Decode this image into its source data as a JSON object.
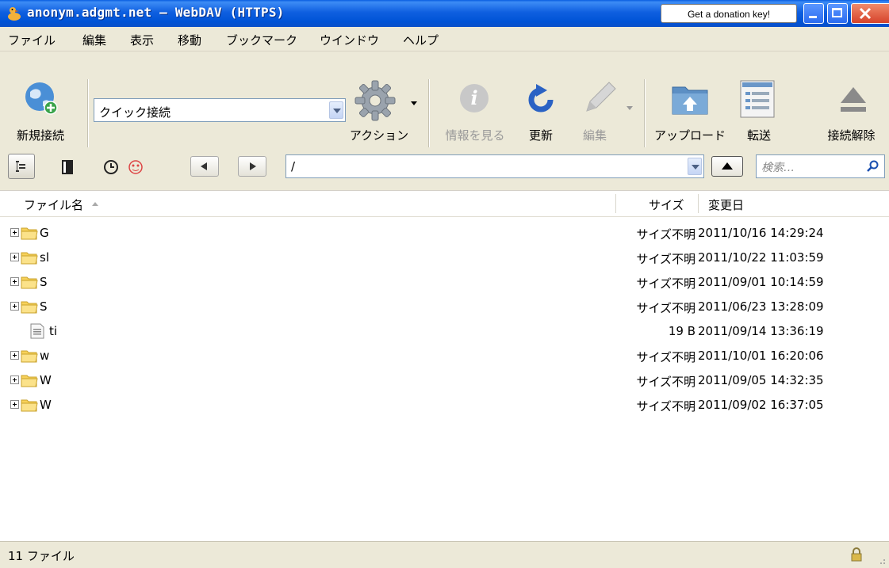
{
  "window": {
    "title": "anonym.adgmt.net – WebDAV (HTTPS)",
    "donation_label": "Get a donation key!"
  },
  "menu": [
    "ファイル",
    "編集",
    "表示",
    "移動",
    "ブックマーク",
    "ウインドウ",
    "ヘルプ"
  ],
  "toolbar": {
    "new_connection": "新規接続",
    "quick_connect_value": "クイック接続",
    "action": "アクション",
    "info": "情報を見る",
    "refresh": "更新",
    "edit": "編集",
    "upload": "アップロード",
    "transfer": "転送",
    "disconnect": "接続解除"
  },
  "nav": {
    "path": "/",
    "search_placeholder": "検索…"
  },
  "table": {
    "columns": {
      "name": "ファイル名",
      "size": "サイズ",
      "modified": "変更日"
    },
    "rows": [
      {
        "type": "folder",
        "name": "G",
        "size": "サイズ不明",
        "modified": "2011/10/16 14:29:24"
      },
      {
        "type": "folder",
        "name": "sl",
        "size": "サイズ不明",
        "modified": "2011/10/22 11:03:59"
      },
      {
        "type": "folder",
        "name": "S",
        "size": "サイズ不明",
        "modified": "2011/09/01 10:14:59"
      },
      {
        "type": "folder",
        "name": "S",
        "size": "サイズ不明",
        "modified": "2011/06/23 13:28:09"
      },
      {
        "type": "file",
        "name": "ti",
        "size": "19 B",
        "modified": "2011/09/14 13:36:19"
      },
      {
        "type": "folder",
        "name": "w",
        "size": "サイズ不明",
        "modified": "2011/10/01 16:20:06"
      },
      {
        "type": "folder",
        "name": "W",
        "size": "サイズ不明",
        "modified": "2011/09/05 14:32:35"
      },
      {
        "type": "folder",
        "name": "W",
        "size": "サイズ不明",
        "modified": "2011/09/02 16:37:05"
      }
    ]
  },
  "status": {
    "count_text": "11 ファイル"
  },
  "icons": {
    "app": "duck-icon",
    "new_connection": "globe-plus-icon",
    "action": "gear-icon",
    "info": "info-icon",
    "refresh": "refresh-icon",
    "edit": "pencil-icon",
    "upload": "upload-folder-icon",
    "transfer": "transfer-list-icon",
    "disconnect": "eject-icon",
    "lock": "lock-icon"
  },
  "colors": {
    "titlebar": "#0053d6",
    "window_bg": "#ece9d8",
    "folder": "#f7d15a"
  }
}
